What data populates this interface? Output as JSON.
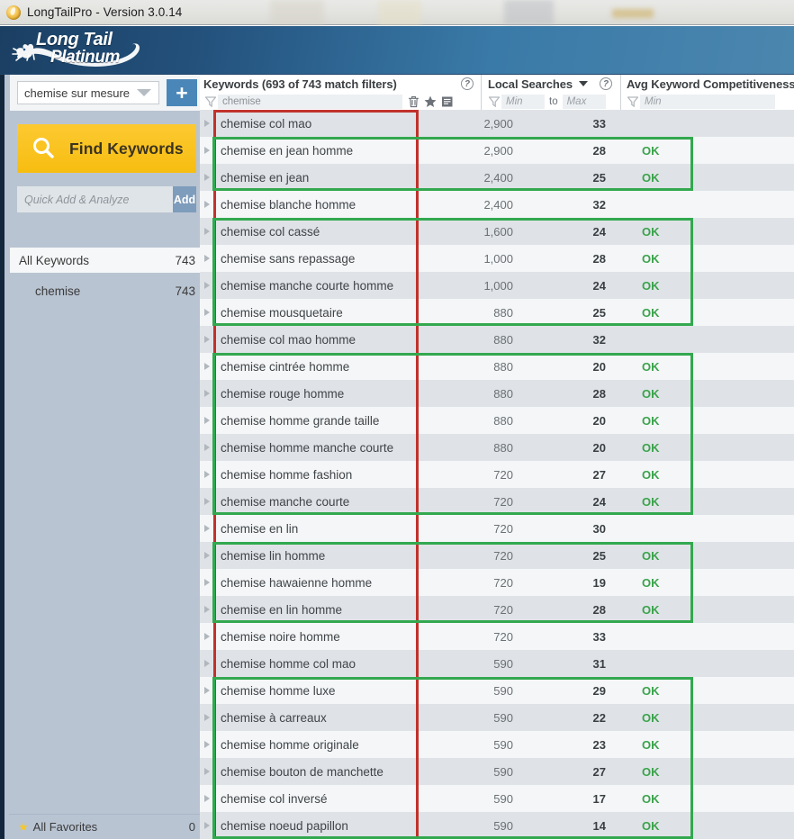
{
  "window": {
    "title": "LongTailPro - Version 3.0.14",
    "icon": "flame-icon"
  },
  "header": {
    "logo_line1": "Long Tail",
    "logo_line2": "Platinum"
  },
  "sidebar": {
    "project_select": {
      "value": "chemise sur mesure",
      "icon": "chevron-down-icon"
    },
    "add_project_button": "+",
    "find_keywords_button": "Find Keywords",
    "quick_add": {
      "placeholder": "Quick Add & Analyze",
      "value": "",
      "button": "Add"
    },
    "all_keywords": {
      "label": "All Keywords",
      "count": "743"
    },
    "keyword_groups": [
      {
        "label": "chemise",
        "count": "743"
      }
    ],
    "favorites": {
      "label": "All Favorites",
      "count": "0",
      "icon": "star-icon"
    }
  },
  "table": {
    "columns": [
      {
        "title": "Keywords (693 of 743 match filters)",
        "filter_value": "chemise",
        "filter_placeholder": "",
        "help": "?",
        "icons": [
          "trash-icon",
          "star-icon",
          "notes-icon"
        ]
      },
      {
        "title": "Local Searches",
        "filter_min_placeholder": "Min",
        "filter_to_label": "to",
        "filter_max_placeholder": "Max",
        "sort": "sort-descending-icon",
        "help": "?"
      },
      {
        "title": "Avg Keyword Competitiveness",
        "filter_min_placeholder": "Min"
      }
    ],
    "rows": [
      {
        "keyword": "chemise col mao",
        "local_searches": "2,900",
        "akc": "33",
        "status": ""
      },
      {
        "keyword": "chemise en jean homme",
        "local_searches": "2,900",
        "akc": "28",
        "status": "OK"
      },
      {
        "keyword": "chemise en jean",
        "local_searches": "2,400",
        "akc": "25",
        "status": "OK"
      },
      {
        "keyword": "chemise blanche homme",
        "local_searches": "2,400",
        "akc": "32",
        "status": ""
      },
      {
        "keyword": "chemise col cassé",
        "local_searches": "1,600",
        "akc": "24",
        "status": "OK"
      },
      {
        "keyword": "chemise sans repassage",
        "local_searches": "1,000",
        "akc": "28",
        "status": "OK"
      },
      {
        "keyword": "chemise manche courte homme",
        "local_searches": "1,000",
        "akc": "24",
        "status": "OK"
      },
      {
        "keyword": "chemise mousquetaire",
        "local_searches": "880",
        "akc": "25",
        "status": "OK"
      },
      {
        "keyword": "chemise col mao homme",
        "local_searches": "880",
        "akc": "32",
        "status": ""
      },
      {
        "keyword": "chemise cintrée homme",
        "local_searches": "880",
        "akc": "20",
        "status": "OK"
      },
      {
        "keyword": "chemise rouge homme",
        "local_searches": "880",
        "akc": "28",
        "status": "OK"
      },
      {
        "keyword": "chemise homme grande taille",
        "local_searches": "880",
        "akc": "20",
        "status": "OK"
      },
      {
        "keyword": "chemise homme manche courte",
        "local_searches": "880",
        "akc": "20",
        "status": "OK"
      },
      {
        "keyword": "chemise homme fashion",
        "local_searches": "720",
        "akc": "27",
        "status": "OK"
      },
      {
        "keyword": "chemise manche courte",
        "local_searches": "720",
        "akc": "24",
        "status": "OK"
      },
      {
        "keyword": "chemise en lin",
        "local_searches": "720",
        "akc": "30",
        "status": ""
      },
      {
        "keyword": "chemise lin homme",
        "local_searches": "720",
        "akc": "25",
        "status": "OK"
      },
      {
        "keyword": "chemise hawaienne homme",
        "local_searches": "720",
        "akc": "19",
        "status": "OK"
      },
      {
        "keyword": "chemise en lin homme",
        "local_searches": "720",
        "akc": "28",
        "status": "OK"
      },
      {
        "keyword": "chemise noire homme",
        "local_searches": "720",
        "akc": "33",
        "status": ""
      },
      {
        "keyword": "chemise homme col mao",
        "local_searches": "590",
        "akc": "31",
        "status": ""
      },
      {
        "keyword": "chemise homme luxe",
        "local_searches": "590",
        "akc": "29",
        "status": "OK"
      },
      {
        "keyword": "chemise à carreaux",
        "local_searches": "590",
        "akc": "22",
        "status": "OK"
      },
      {
        "keyword": "chemise homme originale",
        "local_searches": "590",
        "akc": "23",
        "status": "OK"
      },
      {
        "keyword": "chemise bouton de manchette",
        "local_searches": "590",
        "akc": "27",
        "status": "OK"
      },
      {
        "keyword": "chemise col inversé",
        "local_searches": "590",
        "akc": "17",
        "status": "OK"
      },
      {
        "keyword": "chemise noeud papillon",
        "local_searches": "590",
        "akc": "14",
        "status": "OK"
      }
    ]
  },
  "annotations": {
    "colors": {
      "red": "#c0322c",
      "green": "#33a84f"
    },
    "red_boxes": [
      {
        "first_row": 0,
        "last_row": 26
      }
    ],
    "green_boxes": [
      {
        "first_row": 1,
        "last_row": 2
      },
      {
        "first_row": 4,
        "last_row": 7
      },
      {
        "first_row": 9,
        "last_row": 14
      },
      {
        "first_row": 16,
        "last_row": 18
      },
      {
        "first_row": 21,
        "last_row": 26
      }
    ]
  }
}
